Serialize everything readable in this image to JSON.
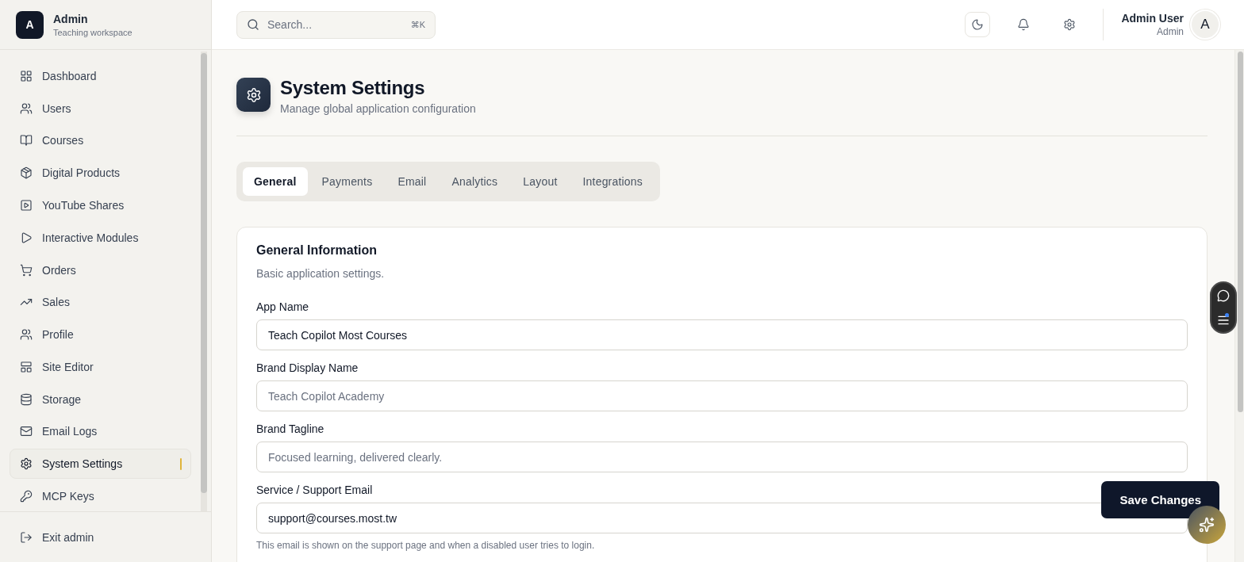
{
  "workspace": {
    "initial": "A",
    "name": "Admin",
    "subtitle": "Teaching workspace"
  },
  "sidebar": {
    "items": [
      {
        "kind": "dashboard",
        "label": "Dashboard",
        "selected": false
      },
      {
        "kind": "users",
        "label": "Users",
        "selected": false
      },
      {
        "kind": "book",
        "label": "Courses",
        "selected": false
      },
      {
        "kind": "package",
        "label": "Digital Products",
        "selected": false
      },
      {
        "kind": "video",
        "label": "YouTube Shares",
        "selected": false
      },
      {
        "kind": "play",
        "label": "Interactive Modules",
        "selected": false
      },
      {
        "kind": "cart",
        "label": "Orders",
        "selected": false
      },
      {
        "kind": "trend",
        "label": "Sales",
        "selected": false
      },
      {
        "kind": "users",
        "label": "Profile",
        "selected": false
      },
      {
        "kind": "layout",
        "label": "Site Editor",
        "selected": false
      },
      {
        "kind": "database",
        "label": "Storage",
        "selected": false
      },
      {
        "kind": "mail",
        "label": "Email Logs",
        "selected": false
      },
      {
        "kind": "settings",
        "label": "System Settings",
        "selected": true
      },
      {
        "kind": "key",
        "label": "MCP Keys",
        "selected": false
      }
    ],
    "footer": {
      "label": "Exit admin"
    }
  },
  "search": {
    "placeholder": "Search...",
    "shortcut": "⌘K"
  },
  "user": {
    "name": "Admin User",
    "role": "Admin",
    "initial": "A"
  },
  "page": {
    "title": "System Settings",
    "subtitle": "Manage global application configuration"
  },
  "tabs": [
    {
      "label": "General",
      "selected": true
    },
    {
      "label": "Payments",
      "selected": false
    },
    {
      "label": "Email",
      "selected": false
    },
    {
      "label": "Analytics",
      "selected": false
    },
    {
      "label": "Layout",
      "selected": false
    },
    {
      "label": "Integrations",
      "selected": false
    }
  ],
  "card": {
    "title": "General Information",
    "description": "Basic application settings.",
    "fields": [
      {
        "label": "App Name",
        "value": "Teach Copilot Most Courses"
      },
      {
        "label": "Brand Display Name",
        "placeholder": "Teach Copilot Academy"
      },
      {
        "label": "Brand Tagline",
        "placeholder": "Focused learning, delivered clearly."
      },
      {
        "label": "Service / Support Email",
        "value": "support@courses.most.tw",
        "help": "This email is shown on the support page and when a disabled user tries to login."
      }
    ]
  },
  "save_button": "Save Changes"
}
